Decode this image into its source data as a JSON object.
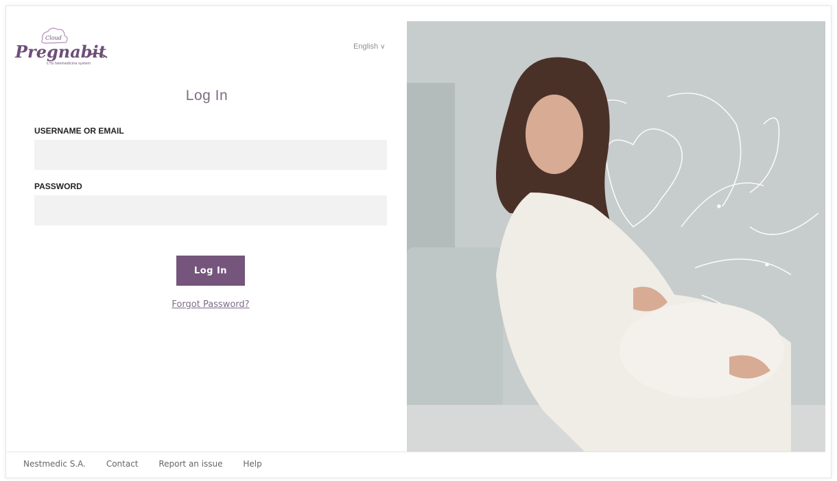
{
  "app": {
    "logo_badge": "Cloud",
    "logo_text": "Pregnabit",
    "logo_tagline": "CTG telemedicine system"
  },
  "language": {
    "selected": "English",
    "chevron_icon": "chevron-down-icon"
  },
  "login": {
    "title": "Log In",
    "username_label": "USERNAME OR EMAIL",
    "username_value": "",
    "password_label": "PASSWORD",
    "password_value": "",
    "submit_label": "Log In",
    "forgot_label": "Forgot Password?"
  },
  "footer": {
    "company": "Nestmedic S.A.",
    "contact": "Contact",
    "report": "Report an issue",
    "help": "Help"
  },
  "colors": {
    "accent": "#75557c",
    "title": "#7e6b86",
    "input_bg": "#f2f2f2"
  }
}
